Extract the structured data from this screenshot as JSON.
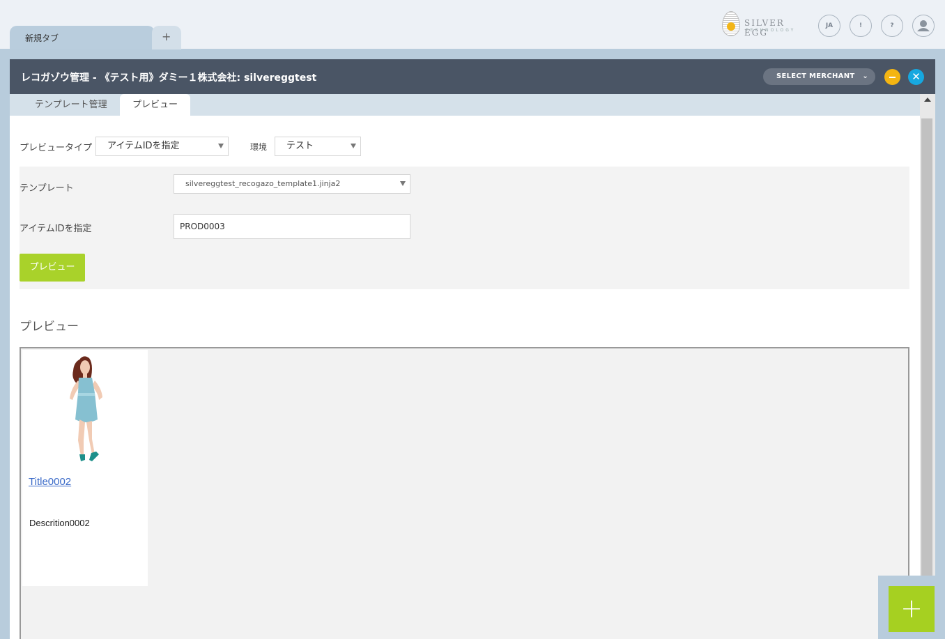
{
  "browser": {
    "tabs": [
      {
        "label": "新規タブ"
      }
    ],
    "add_tab": "+"
  },
  "logo": {
    "name": "SILVER EGG",
    "sub": "TECHNOLOGY"
  },
  "header_buttons": {
    "language": "JA",
    "alert": "!",
    "help": "?"
  },
  "window": {
    "title": "レコガゾウ管理 - 《テスト用》ダミー１株式会社: silvereggtest",
    "merchant_button": "SELECT MERCHANT",
    "close_label": "✕"
  },
  "tabs": [
    {
      "label": "テンプレート管理",
      "active": false
    },
    {
      "label": "プレビュー",
      "active": true
    }
  ],
  "form": {
    "preview_type_label": "プレビュータイプ",
    "preview_type_value": "アイテムIDを指定",
    "env_label": "環境",
    "env_value": "テスト",
    "template_label": "テンプレート",
    "template_value": "silvereggtest_recogazo_template1.jinja2",
    "item_id_label": "アイテムIDを指定",
    "item_id_value": "PROD0003",
    "preview_button": "プレビュー"
  },
  "preview": {
    "section_title": "プレビュー",
    "card": {
      "title": "Title0002",
      "description": "Descrition0002"
    }
  },
  "fab": {
    "label": "+"
  },
  "colors": {
    "accent_green": "#a9d22a",
    "header_dark": "#4a5565",
    "close_blue": "#16a8e0",
    "minimize_yellow": "#f4b512"
  }
}
